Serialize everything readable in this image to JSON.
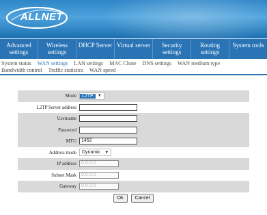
{
  "brand": {
    "logo_text": "ALLNET"
  },
  "main_nav": [
    {
      "label": "Advanced settings"
    },
    {
      "label": "Wireless settings"
    },
    {
      "label": "DHCP Server"
    },
    {
      "label": "Virtual server"
    },
    {
      "label": "Security settings"
    },
    {
      "label": "Routing settings"
    },
    {
      "label": "System tools"
    }
  ],
  "sub_nav": {
    "row1": [
      "System status",
      "WAN settings",
      "LAN settings",
      "MAC Clone",
      "DNS settings",
      "WAN medium type"
    ],
    "row2": [
      "Bandwidth control",
      "Traffic statistics",
      "WAN speed"
    ],
    "active": "WAN settings"
  },
  "form": {
    "mode": {
      "label": "Mode",
      "value": "L2TP"
    },
    "server": {
      "label": "L2TP Server address",
      "value": ""
    },
    "username": {
      "label": "Username",
      "value": ""
    },
    "password": {
      "label": "Password",
      "value": ""
    },
    "mtu": {
      "label": "MTU",
      "value": "1452"
    },
    "address_mode": {
      "label": "Address mode",
      "value": "Dynamic"
    },
    "ip": {
      "label": "IP address",
      "value": "0.0.0.0"
    },
    "mask": {
      "label": "Subnet Mask",
      "value": "0.0.0.0"
    },
    "gateway": {
      "label": "Gateway",
      "value": "0.0.0.0"
    }
  },
  "buttons": {
    "ok": "Ok",
    "cancel": "Cancel"
  },
  "colors": {
    "accent": "#2a74b6",
    "banner": "#3a92d2",
    "row_shade": "#d9d9d9"
  }
}
